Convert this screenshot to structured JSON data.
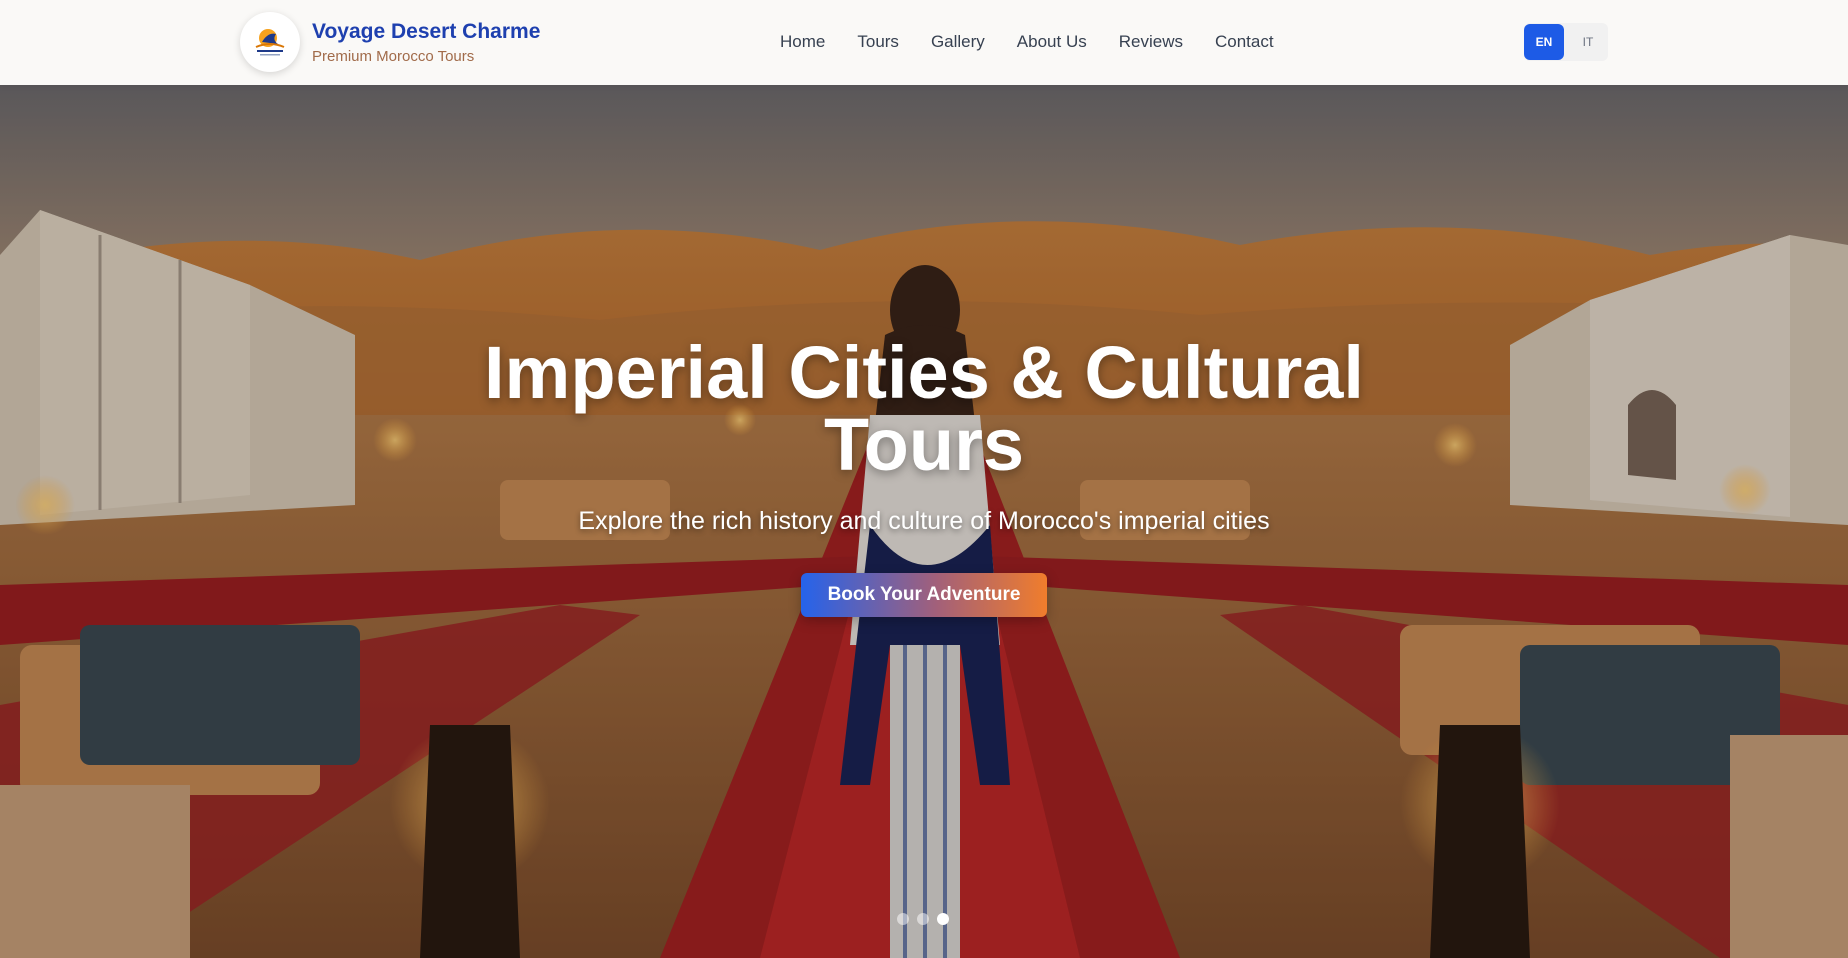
{
  "brand": {
    "title": "Voyage Desert Charme",
    "subtitle": "Premium Morocco Tours",
    "logo_icon": "voyage-desert-logo",
    "title_color": "#1e40af"
  },
  "nav": {
    "items": [
      {
        "label": "Home"
      },
      {
        "label": "Tours"
      },
      {
        "label": "Gallery"
      },
      {
        "label": "About Us"
      },
      {
        "label": "Reviews"
      },
      {
        "label": "Contact"
      }
    ]
  },
  "language": {
    "options": [
      "EN",
      "IT"
    ],
    "selected": "EN",
    "accent": "#1d5be6"
  },
  "hero": {
    "title": "Imperial Cities & Cultural Tours",
    "subtitle": "Explore the rich history and culture of Morocco's imperial cities",
    "cta_label": "Book Your Adventure",
    "slide_count": 3,
    "active_slide": 3,
    "background": "desert-camp-photo"
  }
}
